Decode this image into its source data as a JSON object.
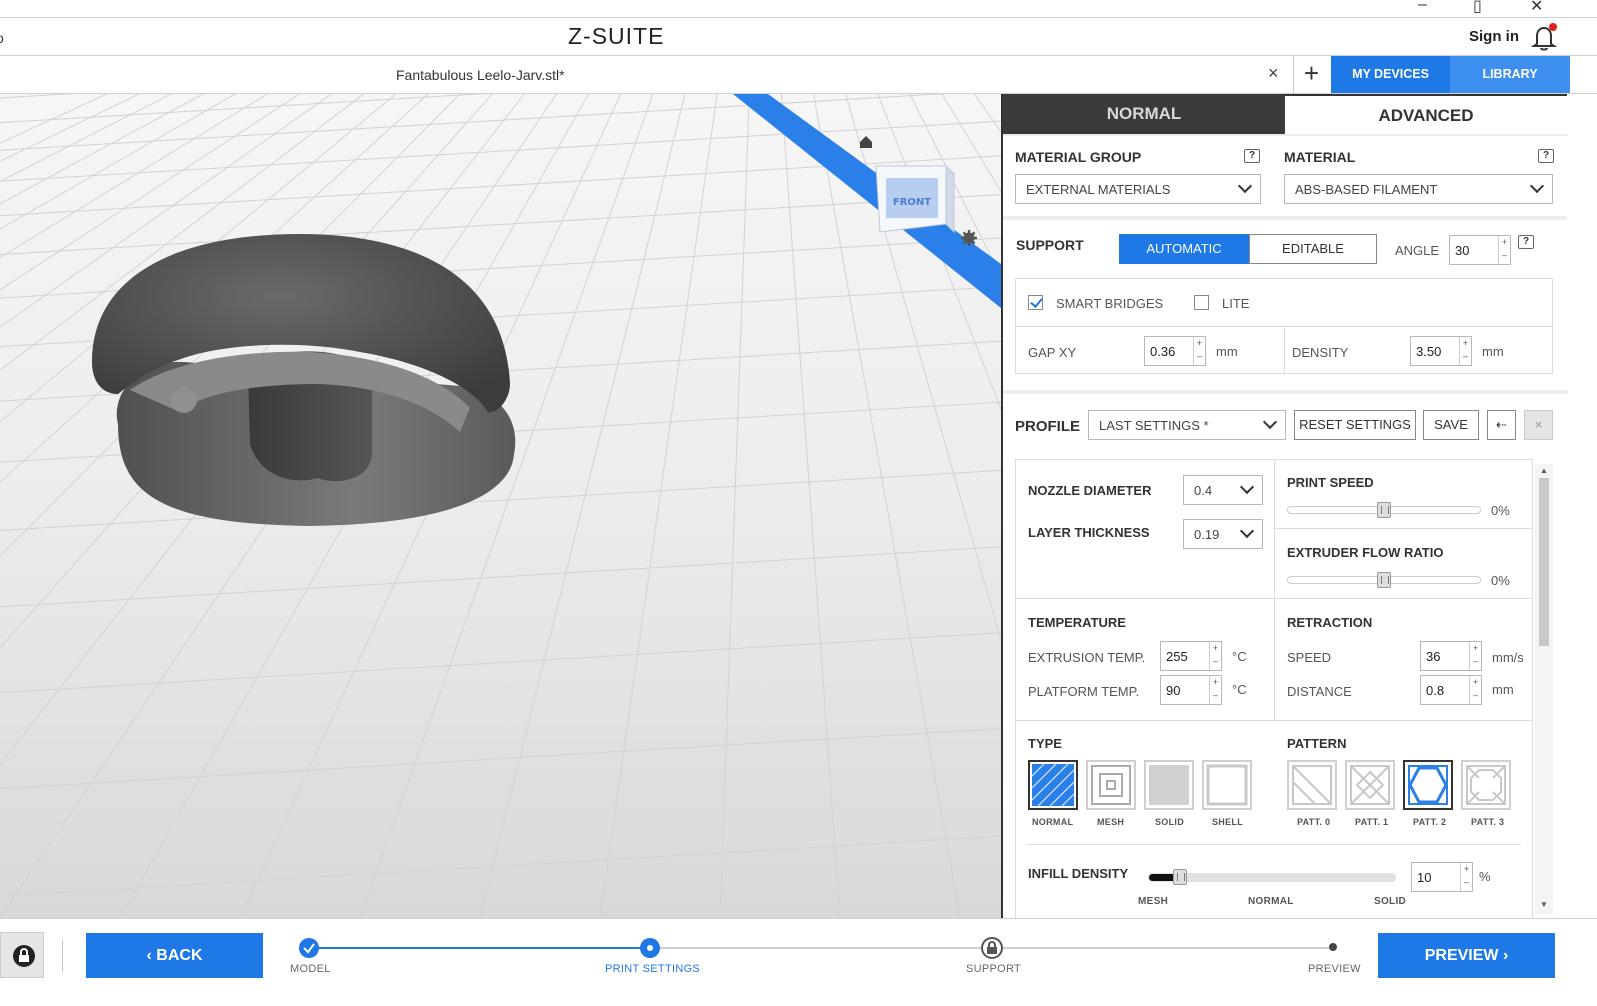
{
  "app": {
    "title": "Z-SUITE",
    "signin": "Sign in",
    "edge_text": "o"
  },
  "tabs": {
    "filename": "Fantabulous Leelo-Jarv.stl*",
    "close": "×",
    "add": "+",
    "my_devices": "MY DEVICES",
    "library": "LIBRARY"
  },
  "viewcube": {
    "face": "FRONT"
  },
  "mode": {
    "normal": "NORMAL",
    "advanced": "ADVANCED"
  },
  "material": {
    "group_label": "MATERIAL GROUP",
    "group_value": "EXTERNAL MATERIALS",
    "material_label": "MATERIAL",
    "material_value": "ABS-BASED FILAMENT",
    "help": "?"
  },
  "support": {
    "label": "SUPPORT",
    "automatic": "AUTOMATIC",
    "editable": "EDITABLE",
    "angle_label": "ANGLE",
    "angle_value": "30",
    "smart_bridges": "SMART BRIDGES",
    "lite": "LITE",
    "gap_label": "GAP XY",
    "gap_value": "0.36",
    "gap_unit": "mm",
    "density_label": "DENSITY",
    "density_value": "3.50",
    "density_unit": "mm"
  },
  "profile": {
    "label": "PROFILE",
    "value": "LAST SETTINGS *",
    "reset": "RESET SETTINGS",
    "save": "SAVE",
    "back_icon": "⇠",
    "close_icon": "×"
  },
  "settings": {
    "nozzle_label": "NOZZLE DIAMETER",
    "nozzle_value": "0.4",
    "layer_label": "LAYER THICKNESS",
    "layer_value": "0.19",
    "print_speed_label": "PRINT SPEED",
    "print_speed_value": "0%",
    "print_speed_level": 0.5,
    "flow_label": "EXTRUDER FLOW RATIO",
    "flow_value": "0%",
    "flow_level": 0.5,
    "temp_label": "TEMPERATURE",
    "extrusion_label": "EXTRUSION TEMP.",
    "extrusion_value": "255",
    "temp_unit": "°C",
    "platform_label": "PLATFORM TEMP.",
    "platform_value": "90",
    "retraction_label": "RETRACTION",
    "speed_label": "SPEED",
    "speed_value": "36",
    "speed_unit": "mm/s",
    "distance_label": "DISTANCE",
    "distance_value": "0.8",
    "distance_unit": "mm",
    "type_label": "TYPE",
    "types": [
      "NORMAL",
      "MESH",
      "SOLID",
      "SHELL"
    ],
    "pattern_label": "PATTERN",
    "patterns": [
      "PATT. 0",
      "PATT. 1",
      "PATT. 2",
      "PATT. 3"
    ],
    "infill_label": "INFILL DENSITY",
    "infill_value": "10",
    "infill_unit": "%",
    "infill_marks": [
      "MESH",
      "NORMAL",
      "SOLID"
    ]
  },
  "bottom": {
    "back": "‹  BACK",
    "preview": "PREVIEW  ›",
    "steps": [
      "MODEL",
      "PRINT SETTINGS",
      "SUPPORT",
      "PREVIEW"
    ]
  },
  "colors": {
    "accent": "#1e78e6",
    "accent_light": "#3d8ff0",
    "dark": "#3a3a3a"
  }
}
